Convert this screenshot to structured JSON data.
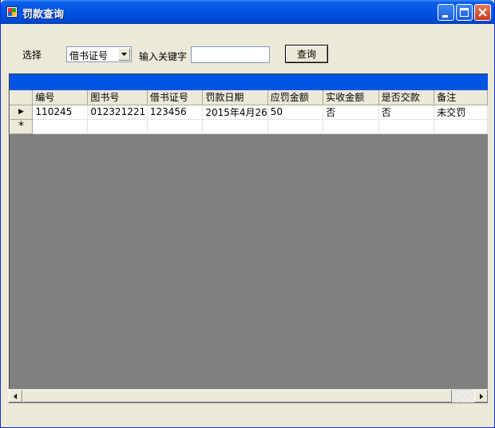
{
  "window": {
    "title": "罚款查询"
  },
  "filter": {
    "select_label": "选择",
    "select_value": "借书证号",
    "keyword_label": "输入关键字",
    "keyword_value": "",
    "query_button": "查询"
  },
  "grid": {
    "columns": [
      "编号",
      "图书号",
      "借书证号",
      "罚款日期",
      "应罚金额",
      "实收金额",
      "是否交款",
      "备注"
    ],
    "rows": [
      [
        "110245",
        "012321221",
        "123456",
        "2015年4月26",
        "50",
        "否",
        "否",
        "未交罚"
      ]
    ],
    "current_row_marker": "▶",
    "new_row_marker": "*"
  },
  "colors": {
    "title_bar": "#0054e3",
    "grid_caption": "#0054e3",
    "grid_background": "#808080",
    "window_face": "#ece9d8"
  }
}
